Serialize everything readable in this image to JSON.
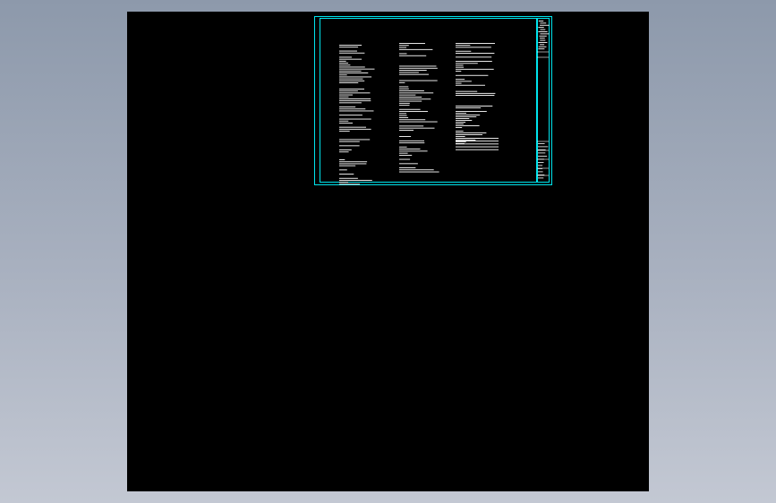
{
  "viewer": {
    "background_color": "#a3adbd",
    "canvas_color": "#000000",
    "frame_color": "#00e5ee",
    "text_color": "#ffffff"
  },
  "drawing": {
    "title_block_icon": "title-block-icon",
    "text_icon": "cad-text-line-icon"
  }
}
